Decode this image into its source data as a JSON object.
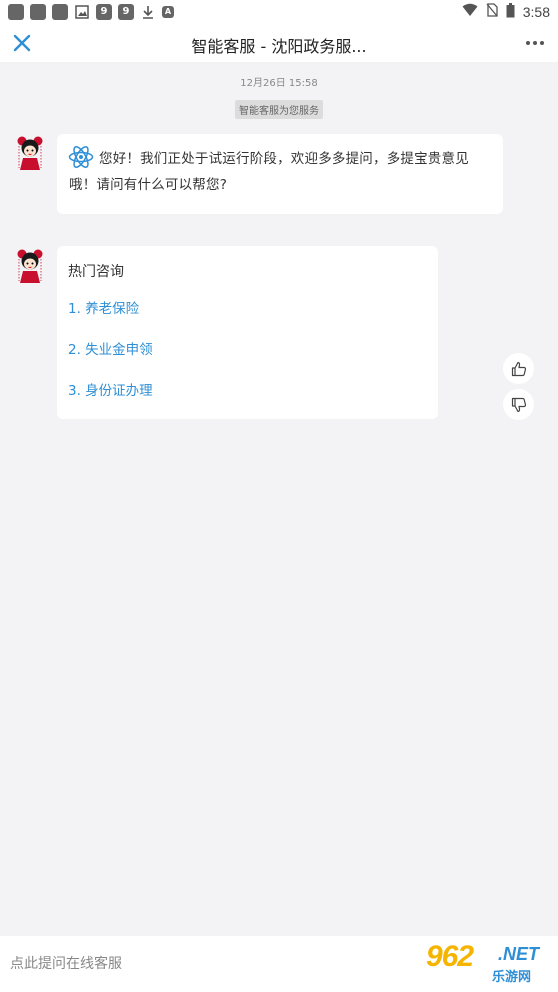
{
  "status_bar": {
    "time": "3:58",
    "left_icons": [
      "app-icon",
      "app-icon",
      "app-icon",
      "image-icon",
      "nine-icon",
      "nine-icon",
      "download-icon",
      "font-icon"
    ],
    "right_icons": [
      "wifi-icon",
      "no-sim-icon",
      "battery-icon"
    ]
  },
  "header": {
    "title": "智能客服 - 沈阳政务服...",
    "close_icon": "close-icon",
    "more_icon": "more-icon",
    "accent_color": "#2f8fd6"
  },
  "chat": {
    "timestamp": "12月26日 15:58",
    "system_notice": "智能客服为您服务",
    "greeting": "您好！我们正处于试运行阶段，欢迎多多提问，多提宝贵意见哦！请问有什么可以帮您?",
    "hot_title": "热门咨询",
    "faq": [
      {
        "label": "1. 养老保险"
      },
      {
        "label": "2. 失业金申领"
      },
      {
        "label": "3. 身份证办理"
      }
    ]
  },
  "feedback": {
    "like_icon": "thumbs-up-icon",
    "dislike_icon": "thumbs-down-icon"
  },
  "input": {
    "placeholder": "点此提问在线客服",
    "value": ""
  },
  "watermark": {
    "number": "962",
    "suffix": ".NET",
    "text": "乐游网"
  }
}
